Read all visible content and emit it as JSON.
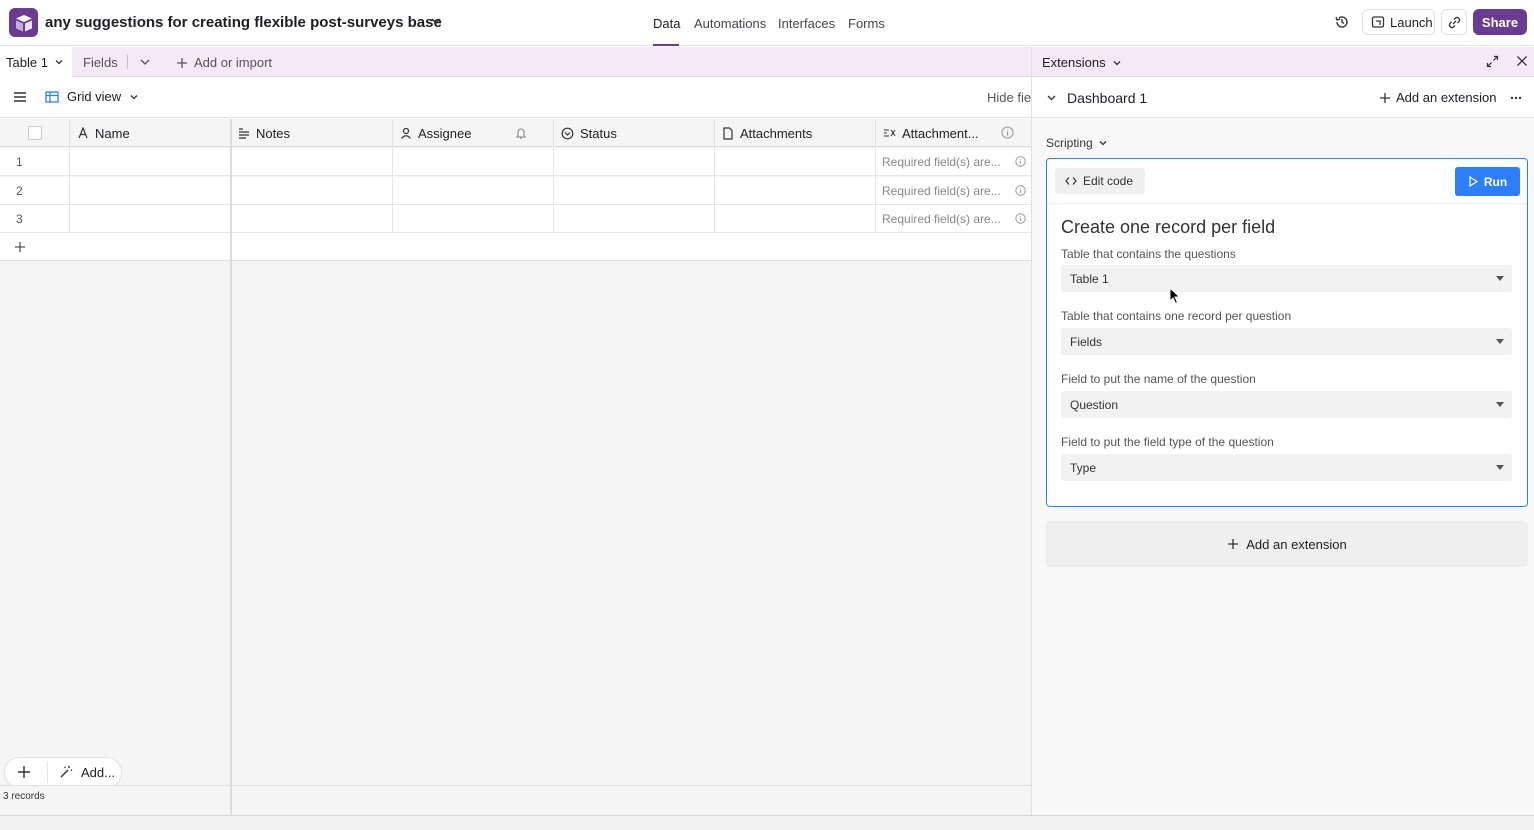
{
  "header": {
    "base_title": "any suggestions for creating flexible post-surveys base",
    "nav": [
      "Data",
      "Automations",
      "Interfaces",
      "Forms"
    ],
    "launch_label": "Launch",
    "share_label": "Share"
  },
  "tabbar": {
    "table_tab": "Table 1",
    "fields_tab": "Fields",
    "add_import": "Add or import"
  },
  "viewbar": {
    "view_name": "Grid view",
    "hide_fields": "Hide fields"
  },
  "grid": {
    "columns": [
      "Name",
      "Notes",
      "Assignee",
      "Status",
      "Attachments",
      "Attachment..."
    ],
    "rows": [
      {
        "num": "1",
        "error": "Required field(s) are..."
      },
      {
        "num": "2",
        "error": "Required field(s) are..."
      },
      {
        "num": "3",
        "error": "Required field(s) are..."
      }
    ],
    "records_count": "3 records",
    "add_label": "Add..."
  },
  "extensions": {
    "title": "Extensions",
    "dashboard": "Dashboard 1",
    "add_extension_top": "Add an extension",
    "scripting_label": "Scripting",
    "edit_code": "Edit code",
    "run": "Run",
    "script_title": "Create one record per field",
    "questions": [
      {
        "label": "Table that contains the questions",
        "value": "Table 1"
      },
      {
        "label": "Table that contains one record per question",
        "value": "Fields"
      },
      {
        "label": "Field to put the name of the question",
        "value": "Question"
      },
      {
        "label": "Field to put the field type of the question",
        "value": "Type"
      }
    ],
    "add_extension_bottom": "Add an extension"
  },
  "colors": {
    "brand": "#6b3b8f",
    "tab_bg": "#f4e9f7",
    "run_blue": "#2d7ff9"
  }
}
